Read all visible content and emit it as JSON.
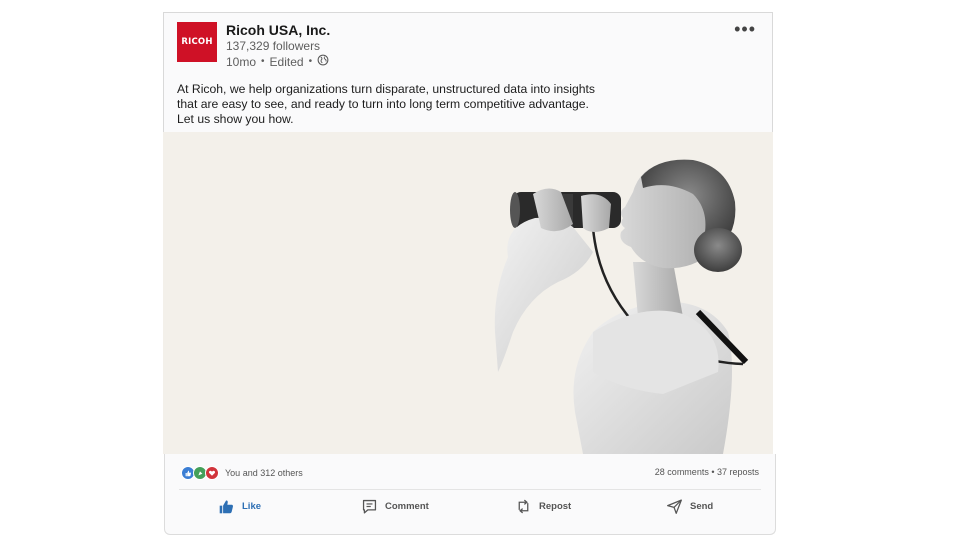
{
  "post": {
    "company": "Ricoh USA, Inc.",
    "logo_text": "RICOH",
    "followers": "137,329 followers",
    "age": "10mo",
    "edited": "Edited",
    "separator": "•",
    "more_label": "•••",
    "text_lines": [
      "At Ricoh, we help organizations turn disparate, unstructured data into insights",
      "that are easy to see, and ready to turn into long term competitive advantage.",
      "Let us show you how."
    ]
  },
  "engagement": {
    "reactions_label": "You and 312 others",
    "stats_label": "28 comments • 37 reposts"
  },
  "actions": {
    "like": "Like",
    "comment": "Comment",
    "repost": "Repost",
    "send": "Send"
  },
  "colors": {
    "brand_red": "#cf1126",
    "like_blue": "#2d6fb4",
    "hero_bg": "#f3f0ea"
  }
}
